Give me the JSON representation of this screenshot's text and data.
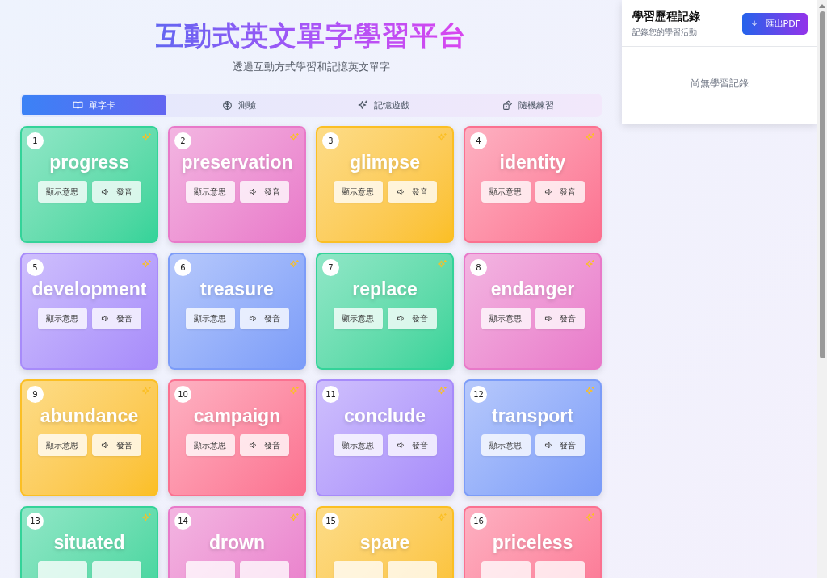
{
  "header": {
    "title": "互動式英文單字學習平台",
    "subtitle": "透過互動方式學習和記憶英文單字"
  },
  "tabs": [
    {
      "label": "單字卡",
      "selected": true
    },
    {
      "label": "測驗",
      "selected": false
    },
    {
      "label": "記憶遊戲",
      "selected": false
    },
    {
      "label": "隨機練習",
      "selected": false
    }
  ],
  "cards": [
    {
      "number": "1",
      "word": "progress",
      "color": "#34d399",
      "reveal": "顯示意思",
      "speak": "發音"
    },
    {
      "number": "2",
      "word": "preservation",
      "color": "#e879c9",
      "reveal": "顯示意思",
      "speak": "發音"
    },
    {
      "number": "3",
      "word": "glimpse",
      "color": "#fbbf24",
      "reveal": "顯示意思",
      "speak": "發音"
    },
    {
      "number": "4",
      "word": "identity",
      "color": "#fb7190",
      "reveal": "顯示意思",
      "speak": "發音"
    },
    {
      "number": "5",
      "word": "development",
      "color": "#a78bfa",
      "reveal": "顯示意思",
      "speak": "發音"
    },
    {
      "number": "6",
      "word": "treasure",
      "color": "#7c9cf8",
      "reveal": "顯示意思",
      "speak": "發音"
    },
    {
      "number": "7",
      "word": "replace",
      "color": "#34d399",
      "reveal": "顯示意思",
      "speak": "發音"
    },
    {
      "number": "8",
      "word": "endanger",
      "color": "#e879c9",
      "reveal": "顯示意思",
      "speak": "發音"
    },
    {
      "number": "9",
      "word": "abundance",
      "color": "#fbbf24",
      "reveal": "顯示意思",
      "speak": "發音"
    },
    {
      "number": "10",
      "word": "campaign",
      "color": "#fb7190",
      "reveal": "顯示意思",
      "speak": "發音"
    },
    {
      "number": "11",
      "word": "conclude",
      "color": "#a78bfa",
      "reveal": "顯示意思",
      "speak": "發音"
    },
    {
      "number": "12",
      "word": "transport",
      "color": "#7c9cf8",
      "reveal": "顯示意思",
      "speak": "發音"
    },
    {
      "number": "13",
      "word": "situated",
      "color": "#34d399"
    },
    {
      "number": "14",
      "word": "drown",
      "color": "#e879c9"
    },
    {
      "number": "15",
      "word": "spare",
      "color": "#fbbf24"
    },
    {
      "number": "16",
      "word": "priceless",
      "color": "#fb7190"
    }
  ],
  "history": {
    "title": "學習歷程記錄",
    "subtitle": "記錄您的學習活動",
    "export_button": "匯出PDF",
    "empty_text": "尚無學習記錄"
  }
}
